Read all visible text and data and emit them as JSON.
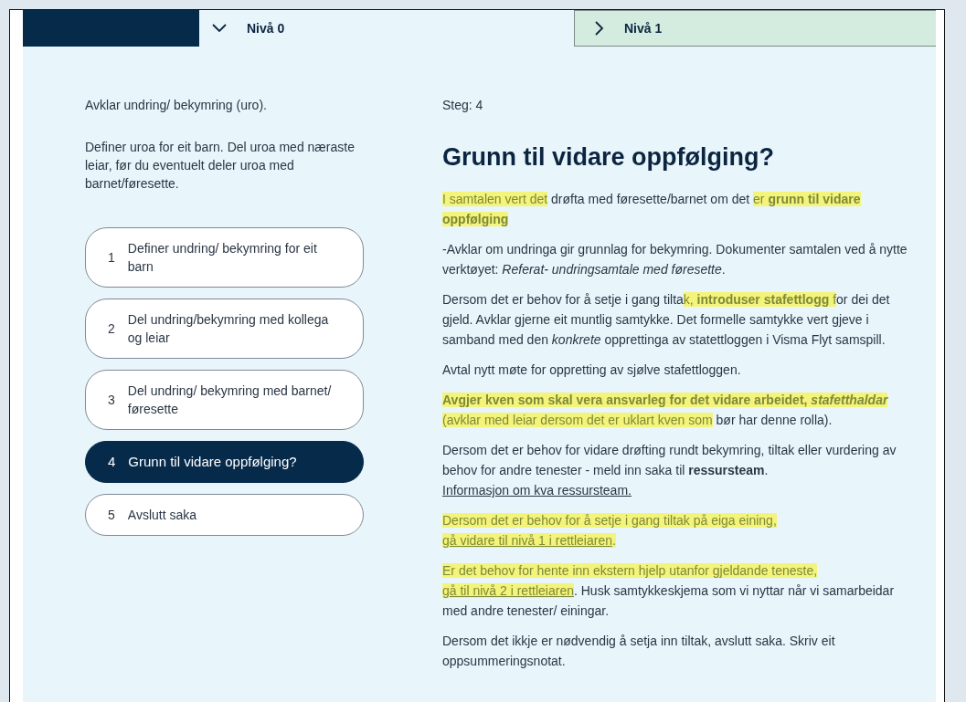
{
  "tabs": [
    {
      "label": "Nivå 0",
      "expanded": true
    },
    {
      "label": "Nivå 1",
      "expanded": false
    }
  ],
  "sidebar": {
    "title": "Avklar undring/ bekymring (uro).",
    "description": "Definer uroa for eit barn. Del uroa med næraste leiar, før du eventuelt deler uroa med barnet/føresette.",
    "steps": [
      {
        "number": "1",
        "label": "Definer undring/ bekymring for eit barn",
        "selected": false
      },
      {
        "number": "2",
        "label": "Del undring/bekymring med kollega og leiar",
        "selected": false
      },
      {
        "number": "3",
        "label": "Del undring/ bekymring med barnet/ føresette",
        "selected": false
      },
      {
        "number": "4",
        "label": "Grunn til vidare oppfølging?",
        "selected": true
      },
      {
        "number": "5",
        "label": "Avslutt saka",
        "selected": false
      }
    ]
  },
  "content": {
    "step_label": "Steg: 4",
    "heading": "Grunn til vidare oppfølging?",
    "paragraphs": [
      [
        {
          "text": "I samtalen vert det",
          "highlight": true
        },
        {
          "text": " drøfta med føresette/barnet om det "
        },
        {
          "text": "er ",
          "highlight": true
        },
        {
          "text": "grunn til vidare oppfølging",
          "bold": true,
          "highlight": true
        }
      ],
      [
        {
          "text": "-Avklar om undringa gir grunnlag for bekymring. Dokumenter samtalen ved å nytte verktøyet: "
        },
        {
          "text": "Referat- undringsamtale med føresette",
          "italic": true
        },
        {
          "text": "."
        }
      ],
      [
        {
          "text": "Dersom det er behov for å setje i gang tilta"
        },
        {
          "text": "k, ",
          "highlight": true
        },
        {
          "text": "introduser stafettlogg",
          "bold": true,
          "highlight": true
        },
        {
          "text": " f",
          "highlight": true
        },
        {
          "text": "or dei det gjeld. Avklar gjerne eit muntlig samtykke. Det formelle samtykke vert gjeve i samband med den "
        },
        {
          "text": "konkrete",
          "italic": true
        },
        {
          "text": " opprettinga av statettloggen i Visma Flyt samspill."
        }
      ],
      [
        {
          "text": "Avtal nytt møte for oppretting av sjølve stafettloggen."
        }
      ],
      [
        {
          "text": "Avgjer kven som skal vera ansvarleg for det vidare arbeidet, ",
          "bold": true,
          "highlight": true
        },
        {
          "text": "stafetthaldar",
          "bold": true,
          "italic": true,
          "highlight": true
        },
        {
          "text": " (avklar med leiar dersom det er uklart kven som",
          "highlight": true
        },
        {
          "text": " bør har denne rolla)."
        }
      ],
      [
        {
          "text": "Dersom det er behov for vidare drøfting rundt bekymring, tiltak eller vurdering av behov for andre tenester - meld inn saka til "
        },
        {
          "text": "ressursteam",
          "bold": true
        },
        {
          "text": "."
        },
        {
          "text": "Informasjon om kva ressursteam.",
          "link": true,
          "block": true
        }
      ],
      [
        {
          "text": "Dersom det er behov for å setje i gang tiltak på eiga eining, ",
          "highlight": true
        },
        {
          "text": "gå vidare til nivå 1 i rettleiaren",
          "link": true,
          "highlight": true
        },
        {
          "text": ".",
          "highlight": true
        }
      ],
      [
        {
          "text": "Er det behov for hente inn ekstern hjelp utanfor gjeldande teneste, ",
          "highlight": true
        },
        {
          "text": "gå til nivå 2 i rettleiaren",
          "link": true,
          "highlight": true
        },
        {
          "text": ". Husk samtykkeskjema som vi nyttar når vi samarbeidar med andre tenester/ einingar."
        }
      ],
      [
        {
          "text": "Dersom det ikkje er nødvendig å setja inn tiltak, avslutt saka. Skriv eit oppsummeringsnotat."
        }
      ]
    ]
  }
}
